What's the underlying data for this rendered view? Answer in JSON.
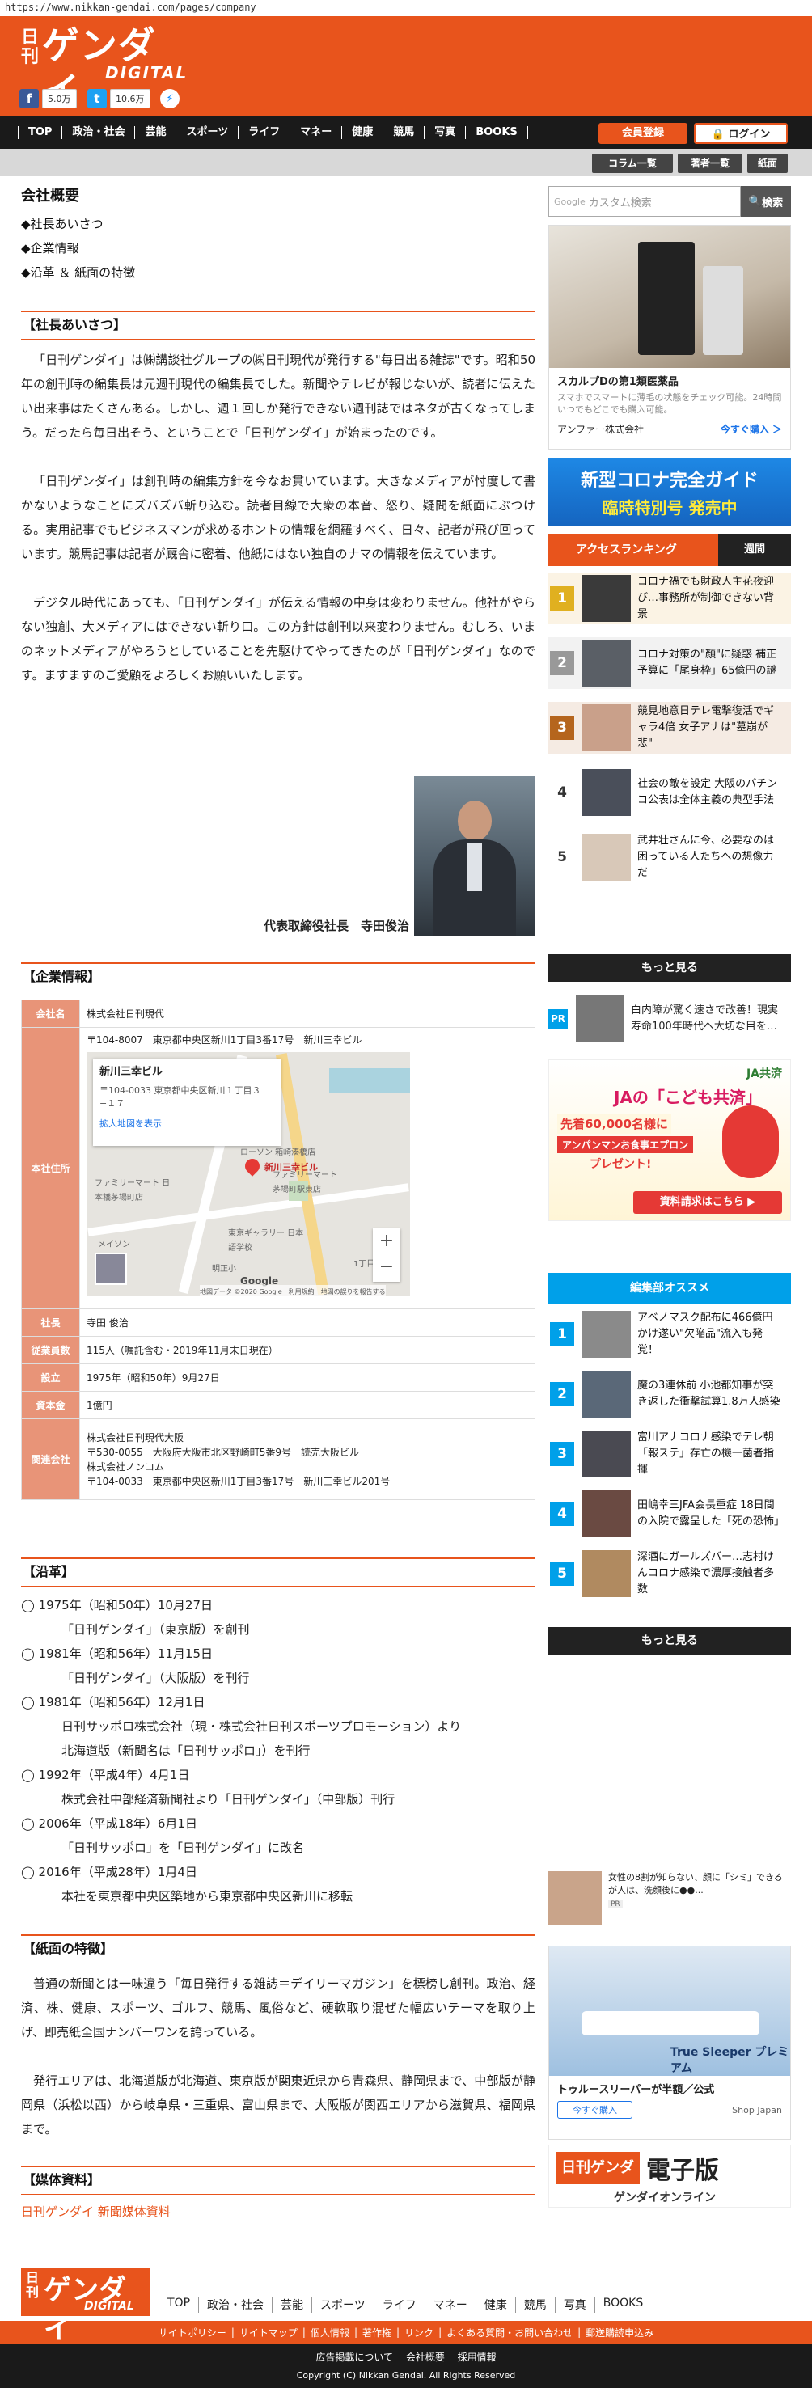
{
  "url": "https://www.nikkan-gendai.com/pages/company",
  "header": {
    "logo_kan": "日刊",
    "logo_main": "ゲンダイ",
    "logo_sub": "DIGITAL",
    "fb_count": "5.0万",
    "tw_count": "10.6万"
  },
  "nav": {
    "items": [
      "TOP",
      "政治・社会",
      "芸能",
      "スポーツ",
      "ライフ",
      "マネー",
      "健康",
      "競馬",
      "写真",
      "BOOKS"
    ],
    "register": "会員登録",
    "login": "ログイン"
  },
  "subnav": {
    "items": [
      "コラム一覧",
      "著者一覧",
      "紙面"
    ]
  },
  "page": {
    "title": "会社概要",
    "links": [
      "◆社長あいさつ",
      "◆企業情報",
      "◆沿革 ＆ 紙面の特徴"
    ]
  },
  "greeting": {
    "heading": "【社長あいさつ】",
    "p1": "「日刊ゲンダイ」は㈱講談社グループの㈱日刊現代が発行する\"毎日出る雑誌\"です。昭和50年の創刊時の編集長は元週刊現代の編集長でした。新聞やテレビが報じないが、読者に伝えたい出来事はたくさんある。しかし、週１回しか発行できない週刊誌ではネタが古くなってしまう。だったら毎日出そう、ということで「日刊ゲンダイ」が始まったのです。",
    "p2": "「日刊ゲンダイ」は創刊時の編集方針を今なお貫いています。大きなメディアが忖度して書かないようなことにズバズバ斬り込む。読者目線で大衆の本音、怒り、疑問を紙面にぶつける。実用記事でもビジネスマンが求めるホントの情報を網羅すべく、日々、記者が飛び回っています。競馬記事は記者が厩舎に密着、他紙にはない独自のナマの情報を伝えています。",
    "p3": "デジタル時代にあっても、「日刊ゲンダイ」が伝える情報の中身は変わりません。他社がやらない独創、大メディアにはできない斬り口。この方針は創刊以来変わりません。むしろ、いまのネットメディアがやろうとしていることを先駆けてやってきたのが「日刊ゲンダイ」なのです。ますますのご愛顧をよろしくお願いいたします。",
    "signature": "代表取締役社長　寺田俊治"
  },
  "company": {
    "heading": "【企業情報】",
    "rows": [
      {
        "label": "会社名",
        "value": "株式会社日刊現代"
      },
      {
        "label": "本社住所",
        "value": "〒104-8007　東京都中央区新川1丁目3番17号　新川三幸ビル"
      },
      {
        "label": "社長",
        "value": "寺田 俊治"
      },
      {
        "label": "従業員数",
        "value": "115人（嘱託含む・2019年11月末日現在）"
      },
      {
        "label": "設立",
        "value": "1975年（昭和50年）9月27日"
      },
      {
        "label": "資本金",
        "value": "1億円"
      },
      {
        "label": "関連会社",
        "lines": [
          "株式会社日刊現代大阪",
          "〒530-0055　大阪府大阪市北区野崎町5番9号　読売大阪ビル",
          "株式会社ノンコム",
          "〒104-0033　東京都中央区新川1丁目3番17号　新川三幸ビル201号"
        ]
      }
    ],
    "map": {
      "card_title": "新川三幸ビル",
      "card_address": "〒104-0033 東京都中央区新川１丁目３−１７",
      "card_link": "拡大地図を表示",
      "pin_label": "新川三幸ビル",
      "labels": [
        "ローソン 箱崎湊橋店",
        "ファミリーマート 茅場町駅東店",
        "ファミリーマート 日本橋茅場町店",
        "東京ギャラリー 日本語学校",
        "明正小",
        "1丁目",
        "メイソン"
      ],
      "google": "Google",
      "footer": "地図データ ©2020 Google　利用規約　地図の誤りを報告する"
    }
  },
  "history": {
    "heading": "【沿革】",
    "items": [
      {
        "date": "◯ 1975年（昭和50年）10月27日",
        "lines": [
          "「日刊ゲンダイ」（東京版）を創刊"
        ]
      },
      {
        "date": "◯ 1981年（昭和56年）11月15日",
        "lines": [
          "「日刊ゲンダイ」（大阪版）を刊行"
        ]
      },
      {
        "date": "◯ 1981年（昭和56年）12月1日",
        "lines": [
          "日刊サッポロ株式会社（現・株式会社日刊スポーツプロモーション）より",
          "北海道版（新聞名は「日刊サッポロ」）を刊行"
        ]
      },
      {
        "date": "◯ 1992年（平成4年）4月1日",
        "lines": [
          "株式会社中部経済新聞社より「日刊ゲンダイ」（中部版）刊行"
        ]
      },
      {
        "date": "◯ 2006年（平成18年）6月1日",
        "lines": [
          "「日刊サッポロ」を「日刊ゲンダイ」に改名"
        ]
      },
      {
        "date": "◯ 2016年（平成28年）1月4日",
        "lines": [
          "本社を東京都中央区築地から東京都中央区新川に移転"
        ]
      }
    ]
  },
  "features": {
    "heading": "【紙面の特徴】",
    "p1": "普通の新聞とは一味違う「毎日発行する雑誌＝デイリーマガジン」を標榜し創刊。政治、経済、株、健康、スポーツ、ゴルフ、競馬、風俗など、硬軟取り混ぜた幅広いテーマを取り上げ、即売紙全国ナンバーワンを誇っている。",
    "p2": "発行エリアは、北海道版が北海道、東京版が関東近県から青森県、静岡県まで、中部版が静岡県（浜松以西）から岐阜県・三重県、富山県まで、大阪版が関西エリアから滋賀県、福岡県まで。"
  },
  "media": {
    "heading": "【媒体資料】",
    "link": "日刊ゲンダイ 新聞媒体資料"
  },
  "sidebar": {
    "search_placeholder": "カスタム検索",
    "search_brand": "Google",
    "search_button": "検索",
    "ad1": {
      "title": "スカルプDの第1類医薬品",
      "desc": "スマホでスマートに薄毛の状態をチェック可能。24時間いつでもどこでも購入可能。",
      "advertiser": "アンファー株式会社",
      "cta": "今すぐ購入 ＞"
    },
    "corona": {
      "line1": "新型コロナ完全ガイド",
      "line2": "臨時特別号 発売中"
    },
    "ranking": {
      "title": "アクセスランキング",
      "tab": "週間",
      "items": [
        {
          "num": "1",
          "text": "コロナ禍でも財政人主花夜迎び…事務所が制御できない背景"
        },
        {
          "num": "2",
          "text": "コロナ対策の\"顔\"に疑惑 補正予算に「尾身枠」65億円の謎"
        },
        {
          "num": "3",
          "text": "競見地意日テレ電撃復活でギャラ4倍 女子アナは\"墓崩が悲\""
        },
        {
          "num": "4",
          "text": "社会の敵を設定 大阪のパチンコ公表は全体主義の典型手法"
        },
        {
          "num": "5",
          "text": "武井壮さんに今、必要なのは困っている人たちへの想像力だ"
        }
      ],
      "more": "もっと見る"
    },
    "pr": {
      "badge": "PR",
      "text": "白内障が驚く速さで改善！現実寿命100年時代へ大切な目を…"
    },
    "kyosai": {
      "brand": "JA共済",
      "title": "JAの「こども共済」",
      "promo": "先着60,000名様に",
      "gift": "アンパンマンお食事エプロン",
      "present": "プレゼント!",
      "cta": "資料請求はこちら ▶"
    },
    "recommend": {
      "title": "編集部オススメ",
      "items": [
        {
          "num": "1",
          "text": "アベノマスク配布に466億円かけ遂い\"欠陥品\"流入も発覚！"
        },
        {
          "num": "2",
          "text": "魔の3連休前 小池都知事が突き返した衝撃試算1.8万人感染"
        },
        {
          "num": "3",
          "text": "富川アナコロナ感染でテレ朝「報ステ」存亡の機一菌者指揮"
        },
        {
          "num": "4",
          "text": "田嶋幸三JFA会長重症 18日間の入院で露呈した「死の恐怖」"
        },
        {
          "num": "5",
          "text": "深酒にガールズバー…志村けんコロナ感染で濃厚接触者多数"
        }
      ],
      "more": "もっと見る"
    },
    "small_ad": {
      "text": "女性の8割が知らない、顔に「シミ」できるが人は、洗顔後に●●...",
      "badge": "PR"
    },
    "bed_ad": {
      "title": "トゥルースリーパーが半額／公式",
      "cta": "今すぐ購入",
      "brand": "Shop Japan",
      "product": "True Sleeper プレミアム"
    },
    "denshi": {
      "logo": "日刊ゲンダイ",
      "title": "電子版",
      "sub": "ゲンダイオンライン"
    }
  },
  "footer": {
    "nav": [
      "TOP",
      "政治・社会",
      "芸能",
      "スポーツ",
      "ライフ",
      "マネー",
      "健康",
      "競馬",
      "写真",
      "BOOKS"
    ],
    "links": [
      "サイトポリシー",
      "サイトマップ",
      "個人情報",
      "著作権",
      "リンク",
      "よくある質問・お問い合わせ",
      "郵送購読申込み"
    ],
    "links2": [
      "広告掲載について",
      "会社概要",
      "採用情報"
    ],
    "copyright": "Copyright (C) Nikkan Gendai. All Rights Reserved"
  },
  "colors": {
    "brand": "#e8541c",
    "table_head": "#e89478",
    "recommend": "#00a0e9"
  }
}
